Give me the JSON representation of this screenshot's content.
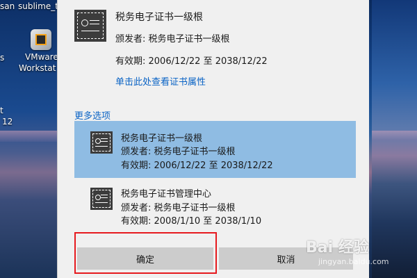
{
  "desktop": {
    "top_left_label": "san",
    "top_icon_label": "sublime_te",
    "vmware_label_1": "VMware",
    "vmware_label_2": "Workstat",
    "left_edge_1": "t",
    "left_edge_2": "12",
    "left_edge_3": "s"
  },
  "dialog": {
    "top_cert": {
      "name": "税务电子证书一级根",
      "issuer": "颁发者: 税务电子证书一级根",
      "validity": "有效期: 2006/12/22 至 2038/12/22"
    },
    "view_props_link": "单击此处查看证书属性",
    "more_options_label": "更多选项",
    "options": [
      {
        "name": "税务电子证书一级根",
        "issuer": "颁发者: 税务电子证书一级根",
        "validity": "有效期: 2006/12/22 至 2038/12/22",
        "selected": true
      },
      {
        "name": "税务电子证书管理中心",
        "issuer": "颁发者: 税务电子证书一级根",
        "validity": "有效期: 2008/1/10 至 2038/1/10",
        "selected": false
      }
    ],
    "ok_label": "确定",
    "cancel_label": "取消"
  },
  "watermark": {
    "text": "Bai 经验",
    "sub": "jingyan.baidu.com"
  },
  "colors": {
    "selected_bg": "#8fbce3",
    "link": "#0a63c5",
    "highlight_box": "#e6191e",
    "button_bg": "#cccccc"
  }
}
